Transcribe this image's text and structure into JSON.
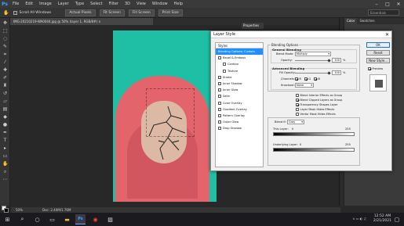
{
  "app": {
    "logo": "Ps"
  },
  "menu": [
    "File",
    "Edit",
    "Image",
    "Layer",
    "Type",
    "Select",
    "Filter",
    "3D",
    "View",
    "Window",
    "Help"
  ],
  "window_controls": {
    "minimize": "–",
    "maximize": "□",
    "close": "✕"
  },
  "options_bar": {
    "scroll_all": "Scroll All Windows",
    "buttons": [
      "Actual Pixels",
      "Fit Screen",
      "Fill Screen",
      "Print Size"
    ],
    "workspace": "Essentials"
  },
  "document": {
    "tab_title": "IMG-20210219-WA0044.jpg @ 50% (layer 1, RGB/8#) ×",
    "zoom": "50%",
    "doc_size": "Doc: 2.40M/1.76M"
  },
  "panels": {
    "properties": [
      "Properties"
    ],
    "color": [
      "Color",
      "Swatches"
    ]
  },
  "dialog": {
    "title": "Layer Style",
    "close": "✕",
    "styles_header": "Styles",
    "styles": [
      {
        "label": "Blending Options: Custom",
        "checkbox": false,
        "indent": false,
        "selected": true
      },
      {
        "label": "Bevel & Emboss",
        "checkbox": true,
        "checked": false,
        "indent": false,
        "selected": false
      },
      {
        "label": "Contour",
        "checkbox": true,
        "checked": false,
        "indent": true,
        "selected": false
      },
      {
        "label": "Texture",
        "checkbox": true,
        "checked": false,
        "indent": true,
        "selected": false
      },
      {
        "label": "Stroke",
        "checkbox": true,
        "checked": false,
        "indent": false,
        "selected": false
      },
      {
        "label": "Inner Shadow",
        "checkbox": true,
        "checked": false,
        "indent": false,
        "selected": false
      },
      {
        "label": "Inner Glow",
        "checkbox": true,
        "checked": false,
        "indent": false,
        "selected": false
      },
      {
        "label": "Satin",
        "checkbox": true,
        "checked": false,
        "indent": false,
        "selected": false
      },
      {
        "label": "Color Overlay",
        "checkbox": true,
        "checked": false,
        "indent": false,
        "selected": false
      },
      {
        "label": "Gradient Overlay",
        "checkbox": true,
        "checked": false,
        "indent": false,
        "selected": false
      },
      {
        "label": "Pattern Overlay",
        "checkbox": true,
        "checked": false,
        "indent": false,
        "selected": false
      },
      {
        "label": "Outer Glow",
        "checkbox": true,
        "checked": false,
        "indent": false,
        "selected": false
      },
      {
        "label": "Drop Shadow",
        "checkbox": true,
        "checked": false,
        "indent": false,
        "selected": false
      }
    ],
    "blending_options": {
      "title": "Blending Options",
      "general": "General Blending",
      "blend_mode_label": "Blend Mode:",
      "blend_mode": "Multiply",
      "opacity_label": "Opacity:",
      "opacity": "100",
      "advanced": "Advanced Blending",
      "fill_label": "Fill Opacity:",
      "fill": "100",
      "channels_label": "Channels:",
      "channels": [
        "R",
        "G",
        "B"
      ],
      "knockout_label": "Knockout:",
      "knockout": "None",
      "checks": [
        {
          "label": "Blend Interior Effects as Group",
          "checked": false
        },
        {
          "label": "Blend Clipped Layers as Group",
          "checked": true
        },
        {
          "label": "Transparency Shapes Layer",
          "checked": true
        },
        {
          "label": "Layer Mask Hides Effects",
          "checked": false
        },
        {
          "label": "Vector Mask Hides Effects",
          "checked": false
        }
      ],
      "blend_if_label": "Blend If:",
      "blend_if": "Gray",
      "this_layer_label": "This Layer:",
      "this_layer_low": "0",
      "this_layer_high": "255",
      "underlying_label": "Underlying Layer:",
      "underlying_low": "0",
      "underlying_high": "255",
      "pct": "%"
    },
    "buttons": {
      "ok": "OK",
      "cancel": "Reset",
      "new_style": "New Style...",
      "preview": "Preview"
    }
  },
  "taskbar": {
    "time": "12:52 AM",
    "date": "2/21/2021",
    "tray": "∧ ▭ ◐ ♫"
  },
  "colors": {
    "accent": "#31a8ff",
    "selection": "#1e90ff",
    "photo_background": "#1fbfa5",
    "hijab": "#e4646b"
  }
}
